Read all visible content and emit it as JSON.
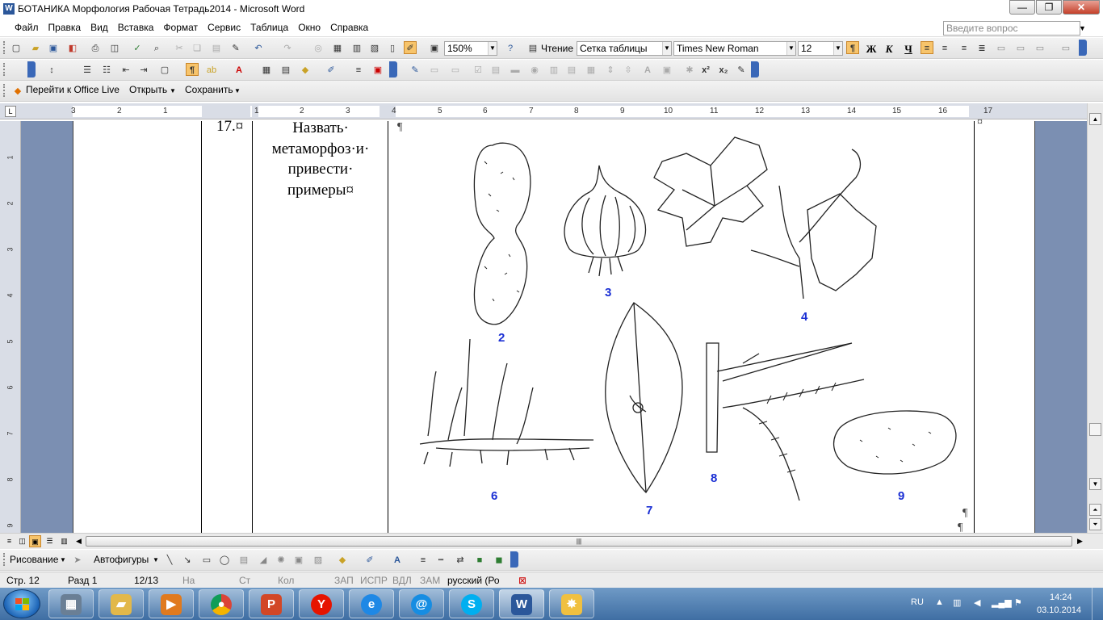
{
  "window": {
    "title": "БОТАНИКА Морфология Рабочая Тетрадь2014 - Microsoft Word",
    "app_icon": "W"
  },
  "menu": [
    "Файл",
    "Правка",
    "Вид",
    "Вставка",
    "Формат",
    "Сервис",
    "Таблица",
    "Окно",
    "Справка"
  ],
  "ask_placeholder": "Введите вопрос",
  "toolbar": {
    "zoom": "150%",
    "reading_label": "Чтение",
    "style": "Сетка таблицы",
    "font": "Times New Roman",
    "size": "12",
    "bold": "Ж",
    "italic": "К",
    "underline": "Ч"
  },
  "officebar": {
    "goto": "Перейти к Office Live",
    "open": "Открыть",
    "save": "Сохранить"
  },
  "ruler": {
    "corner": "L",
    "labels": [
      "3",
      "2",
      "1",
      "1",
      "2",
      "3",
      "4",
      "5",
      "6",
      "7",
      "8",
      "9",
      "10",
      "11",
      "12",
      "13",
      "14",
      "15",
      "16",
      "17"
    ]
  },
  "vruler": [
    "1",
    "2",
    "3",
    "4",
    "5",
    "6",
    "7",
    "8",
    "9",
    "10"
  ],
  "document": {
    "cell_number": "17.¤",
    "cell_task_lines": [
      "Назвать·",
      "метаморфоз·и·",
      "привести·",
      "примеры¤"
    ],
    "pilcrow": "¶",
    "end_cell": "¤",
    "figure_labels": [
      "2",
      "3",
      "4",
      "6",
      "7",
      "8",
      "9"
    ]
  },
  "drawbar": {
    "draw": "Рисование",
    "autoshapes": "Автофигуры"
  },
  "status": {
    "page": "Стр.  12",
    "section": "Разд  1",
    "pages": "12/13",
    "at": "На",
    "line": "Ст",
    "col": "Кол",
    "rec": "ЗАП",
    "trk": "ИСПР",
    "ext": "ВДЛ",
    "ovr": "ЗАМ",
    "language": "русский (Ро"
  },
  "taskbar": {
    "apps": [
      "calculator",
      "explorer",
      "media-player",
      "chrome",
      "powerpoint",
      "yandex",
      "internet-explorer",
      "mail-ru",
      "skype",
      "word",
      "paint"
    ],
    "lang": "RU",
    "time": "14:24",
    "date": "03.10.2014"
  }
}
